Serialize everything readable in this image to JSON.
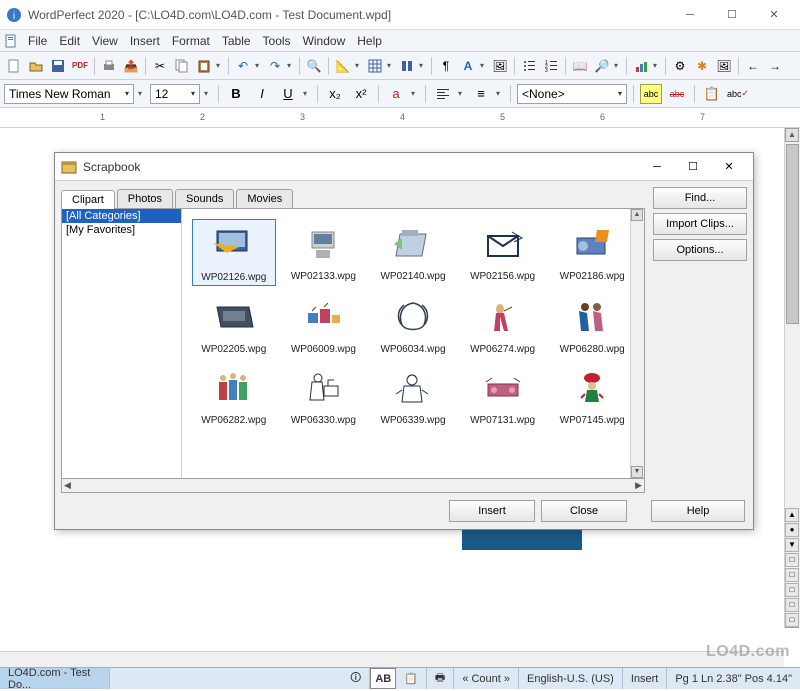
{
  "titlebar": {
    "app": "WordPerfect 2020",
    "doc": "[C:\\LO4D.com\\LO4D.com - Test Document.wpd]"
  },
  "menu": [
    "File",
    "Edit",
    "View",
    "Insert",
    "Format",
    "Table",
    "Tools",
    "Window",
    "Help"
  ],
  "format": {
    "font": "Times New Roman",
    "size": "12",
    "style": "<None>",
    "b": "B",
    "i": "I",
    "u": "U"
  },
  "ruler": [
    "1",
    "2",
    "3",
    "4",
    "5",
    "6",
    "7"
  ],
  "status": {
    "doc": "LO4D.com - Test Do...",
    "ab": "AB",
    "count": "« Count »",
    "lang": "English-U.S. (US)",
    "ins": "Insert",
    "pos": "Pg 1 Ln 2.38\" Pos 4.14\""
  },
  "dialog": {
    "title": "Scrapbook",
    "tabs": [
      "Clipart",
      "Photos",
      "Sounds",
      "Movies"
    ],
    "active_tab": 0,
    "cats": [
      "[All Categories]",
      "[My Favorites]"
    ],
    "sel_cat": 0,
    "buttons": {
      "find": "Find...",
      "import": "Import Clips...",
      "options": "Options...",
      "insert": "Insert",
      "close": "Close",
      "help": "Help"
    },
    "items": [
      {
        "f": "WP02126.wpg",
        "sel": true
      },
      {
        "f": "WP02133.wpg"
      },
      {
        "f": "WP02140.wpg"
      },
      {
        "f": "WP02156.wpg"
      },
      {
        "f": "WP02186.wpg"
      },
      {
        "f": "WP02205.wpg"
      },
      {
        "f": "WP06009.wpg"
      },
      {
        "f": "WP06034.wpg"
      },
      {
        "f": "WP06274.wpg"
      },
      {
        "f": "WP06280.wpg"
      },
      {
        "f": "WP06282.wpg"
      },
      {
        "f": "WP06330.wpg"
      },
      {
        "f": "WP06339.wpg"
      },
      {
        "f": "WP07131.wpg"
      },
      {
        "f": "WP07145.wpg"
      }
    ]
  },
  "watermark": "LO4D.com"
}
